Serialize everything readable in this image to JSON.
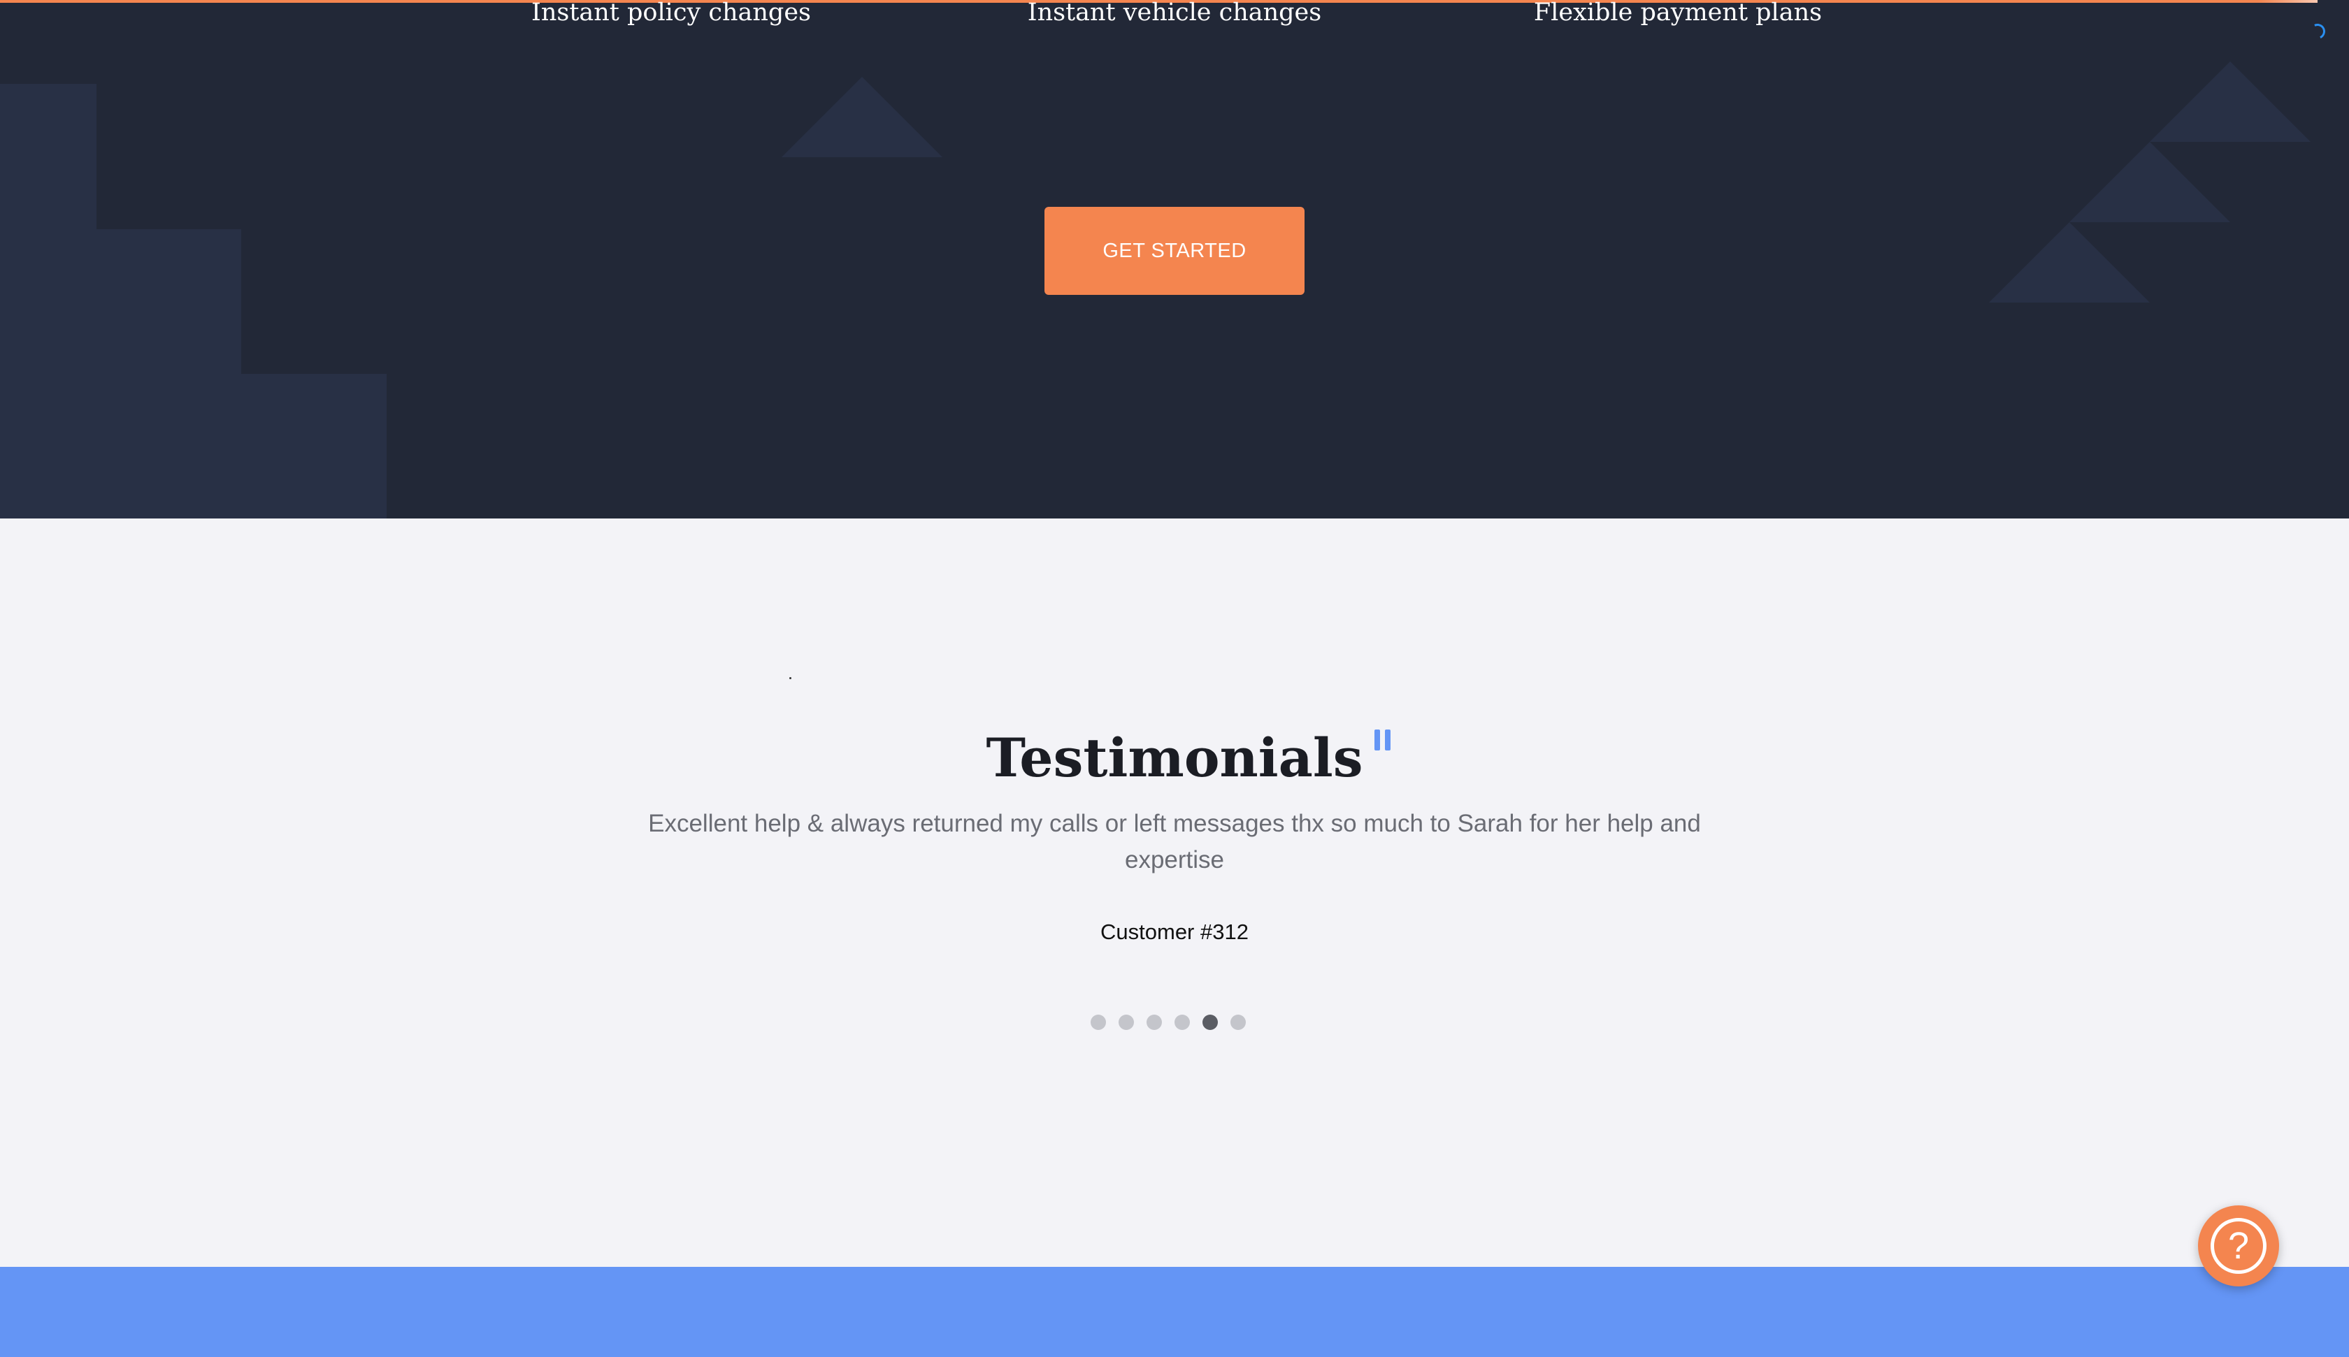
{
  "hero": {
    "features": [
      "Instant policy changes",
      "Instant vehicle changes",
      "Flexible payment plans"
    ],
    "cta_label": "GET STARTED"
  },
  "testimonials": {
    "title": "Testimonials",
    "quote": "Excellent help & always returned my calls or left messages thx so much to Sarah for her help and expertise",
    "author": "Customer #312",
    "slide_count": 6,
    "active_slide": 5
  },
  "help_button": {
    "icon": "question-circle-icon",
    "glyph": "?"
  },
  "colors": {
    "hero_background": "#222837",
    "accent_orange": "#f4854f",
    "accent_blue": "#6495f5",
    "section_background": "#f3f3f7",
    "shape_color": "#283045"
  }
}
